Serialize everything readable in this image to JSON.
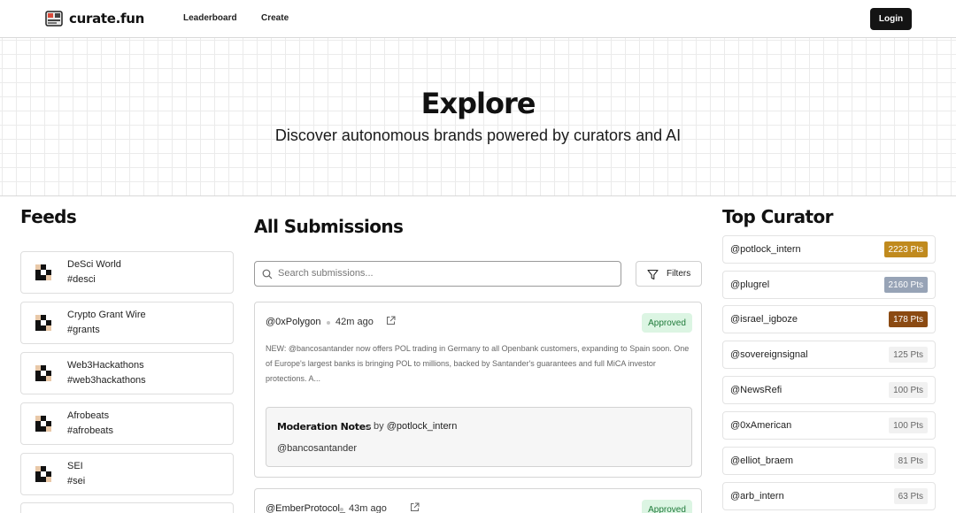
{
  "header": {
    "logo_text": "curate.fun",
    "nav": [
      "Leaderboard",
      "Create"
    ],
    "login_label": "Login"
  },
  "hero": {
    "title": "Explore",
    "subtitle": "Discover autonomous brands powered by curators and AI"
  },
  "feeds": {
    "title": "Feeds",
    "items": [
      {
        "name": "DeSci World",
        "tag": "#desci"
      },
      {
        "name": "Crypto Grant Wire",
        "tag": "#grants"
      },
      {
        "name": "Web3Hackathons",
        "tag": "#web3hackathons"
      },
      {
        "name": "Afrobeats",
        "tag": "#afrobeats"
      },
      {
        "name": "SEI",
        "tag": "#sei"
      }
    ]
  },
  "submissions": {
    "title": "All Submissions",
    "search_placeholder": "Search submissions...",
    "filters_label": "Filters",
    "items": [
      {
        "user": "@0xPolygon",
        "time": "42m ago",
        "status": "Approved",
        "body": "NEW: @bancosantander now offers POL trading in Germany to all Openbank customers, expanding to Spain soon. One of Europe's largest banks is bringing POL to millions, backed by Santander's guarantees and full MiCA investor protections. A...",
        "notes_title": "Moderation Notes",
        "notes_by_prefix": "by",
        "notes_by": "@potlock_intern",
        "notes_text": "@bancosantander"
      },
      {
        "user": "@EmberProtocol_",
        "time": "43m ago",
        "status": "Approved"
      }
    ]
  },
  "curators": {
    "title": "Top Curator",
    "items": [
      {
        "name": "@potlock_intern",
        "points": "2223 Pts",
        "color": "#c08a1e"
      },
      {
        "name": "@plugrel",
        "points": "2160 Pts",
        "color": "#97a3b6"
      },
      {
        "name": "@israel_igboze",
        "points": "178 Pts",
        "color": "#8b4a12"
      },
      {
        "name": "@sovereignsignal",
        "points": "125 Pts",
        "color": "#f1f1f1"
      },
      {
        "name": "@NewsRefi",
        "points": "100 Pts",
        "color": "#f1f1f1"
      },
      {
        "name": "@0xAmerican",
        "points": "100 Pts",
        "color": "#f1f1f1"
      },
      {
        "name": "@elliot_braem",
        "points": "81 Pts",
        "color": "#f1f1f1"
      },
      {
        "name": "@arb_intern",
        "points": "63 Pts",
        "color": "#f1f1f1"
      }
    ]
  }
}
